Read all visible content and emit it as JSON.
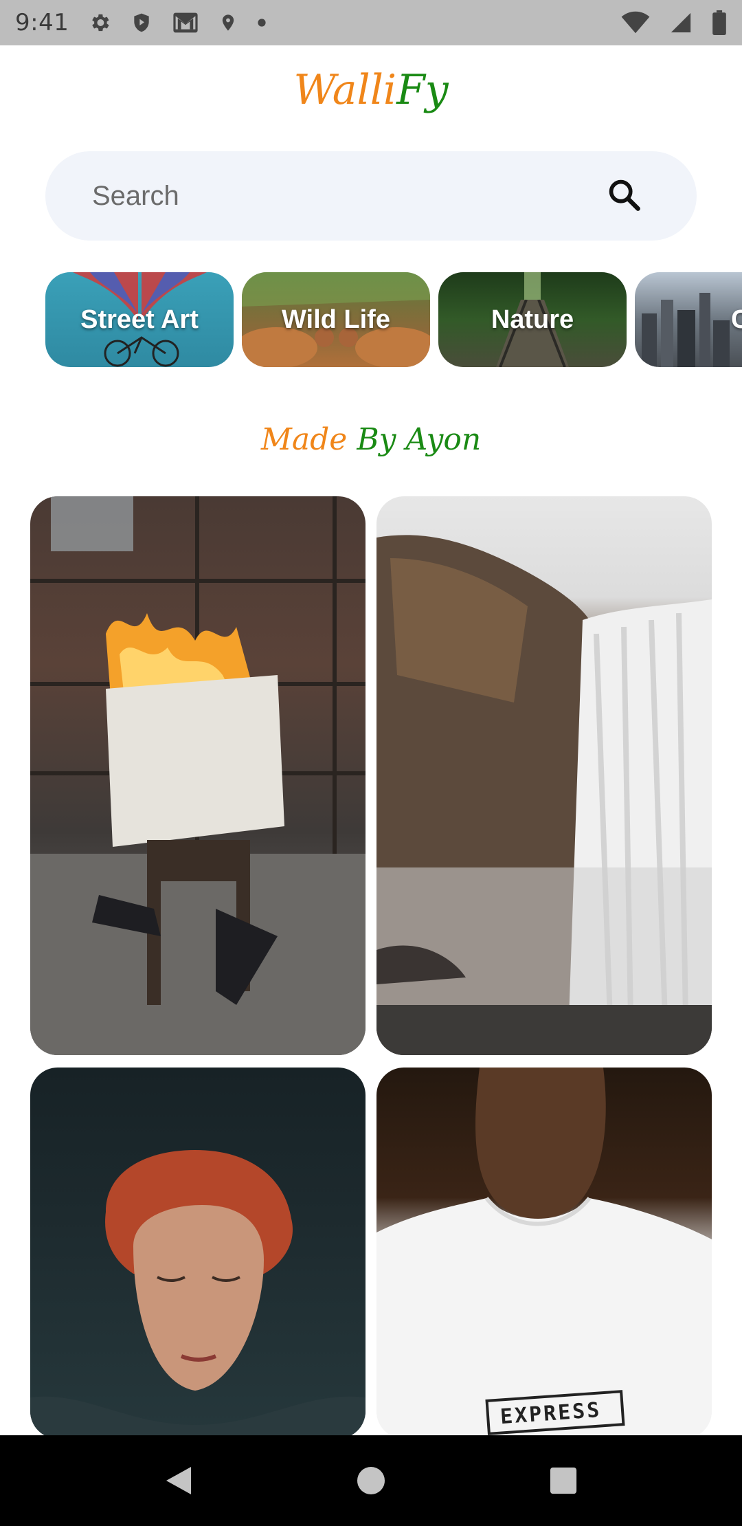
{
  "status_bar": {
    "time": "9:41",
    "icons_left": [
      "gear-icon",
      "play-protect-icon",
      "gmail-icon",
      "location-icon",
      "dot-icon"
    ],
    "icons_right": [
      "wifi-icon",
      "signal-icon",
      "battery-icon"
    ]
  },
  "app": {
    "title_part1": "Walli",
    "title_part2": "Fy",
    "title_color1": "#f0861a",
    "title_color2": "#1a8a14"
  },
  "search": {
    "placeholder": "Search",
    "icon": "search-icon"
  },
  "categories": [
    {
      "label": "Street Art"
    },
    {
      "label": "Wild Life"
    },
    {
      "label": "Nature"
    },
    {
      "label": "City"
    }
  ],
  "credit": {
    "part1": "Made",
    "part2": "By Ayon"
  },
  "photos": [
    {
      "name": "burning-newspaper-photo"
    },
    {
      "name": "waterfall-photo"
    },
    {
      "name": "woman-portrait-photo",
      "text": ""
    },
    {
      "name": "express-tshirt-photo",
      "text": "EXPRESS"
    }
  ],
  "navbar": {
    "back": "back-icon",
    "home": "home-icon",
    "recents": "recents-icon"
  }
}
